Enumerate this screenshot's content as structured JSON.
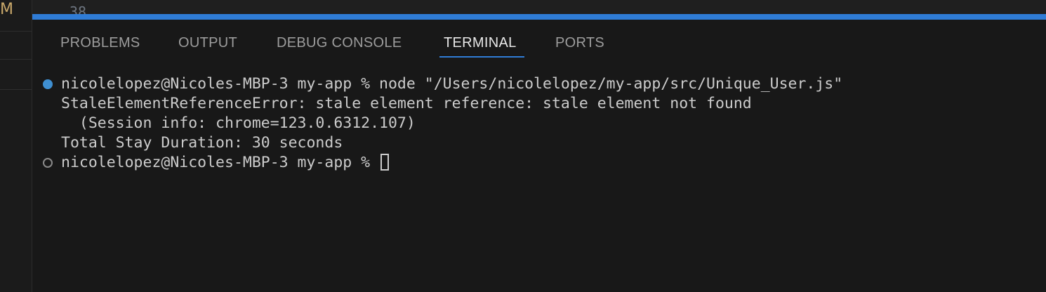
{
  "activity": {
    "letter": "M"
  },
  "editor": {
    "visible_line_number": "38"
  },
  "panel": {
    "tabs": [
      {
        "label": "PROBLEMS",
        "active": false
      },
      {
        "label": "OUTPUT",
        "active": false
      },
      {
        "label": "DEBUG CONSOLE",
        "active": false
      },
      {
        "label": "TERMINAL",
        "active": true
      },
      {
        "label": "PORTS",
        "active": false
      }
    ]
  },
  "terminal": {
    "lines": [
      "nicolelopez@Nicoles-MBP-3 my-app % node \"/Users/nicolelopez/my-app/src/Unique_User.js\"",
      "StaleElementReferenceError: stale element reference: stale element not found",
      "  (Session info: chrome=123.0.6312.107)",
      "Total Stay Duration: 30 seconds",
      "nicolelopez@Nicoles-MBP-3 my-app % "
    ],
    "colors": {
      "accent": "#2f7cd6",
      "success_decoration": "#3f8fd1",
      "text": "#cccccc"
    }
  }
}
